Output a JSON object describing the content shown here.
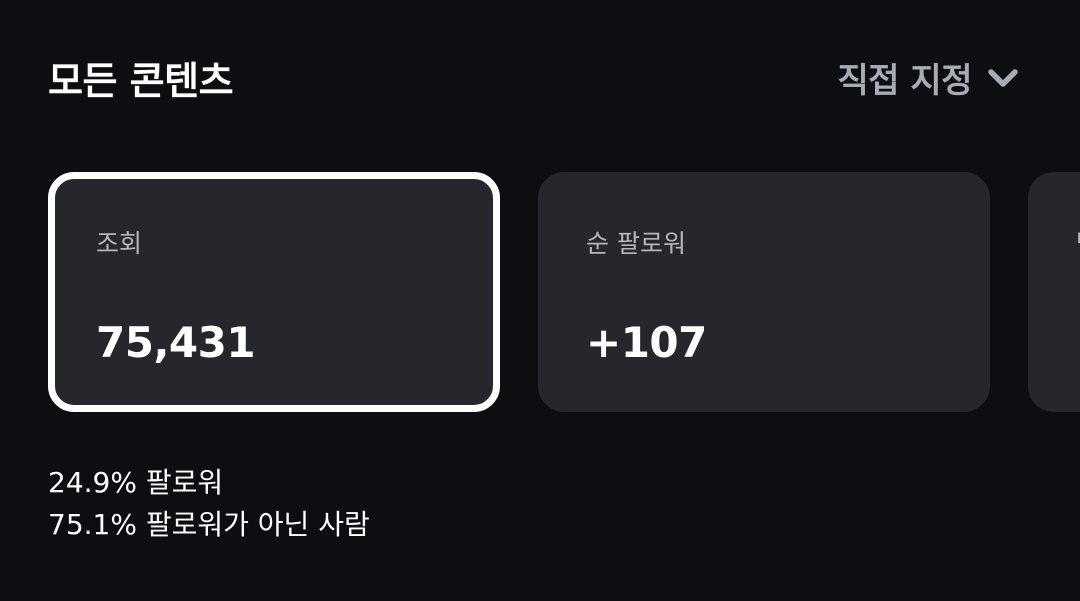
{
  "header": {
    "title": "모든 콘텐츠",
    "date_range_label": "직접 지정",
    "date_range_icon": "chevron-down-icon"
  },
  "cards": [
    {
      "label": "조회",
      "value": "75,431",
      "selected": true
    },
    {
      "label": "순 팔로워",
      "value": "+107",
      "selected": false
    },
    {
      "label": "방",
      "value": "+",
      "selected": false
    }
  ],
  "breakdown": {
    "followers": "24.9% 팔로워",
    "non_followers": "75.1% 팔로워가 아닌 사람"
  },
  "colors": {
    "background": "#0c0e12",
    "card_background": "#25272c",
    "selected_border": "#ffffff",
    "muted_text": "#a7abb3"
  }
}
